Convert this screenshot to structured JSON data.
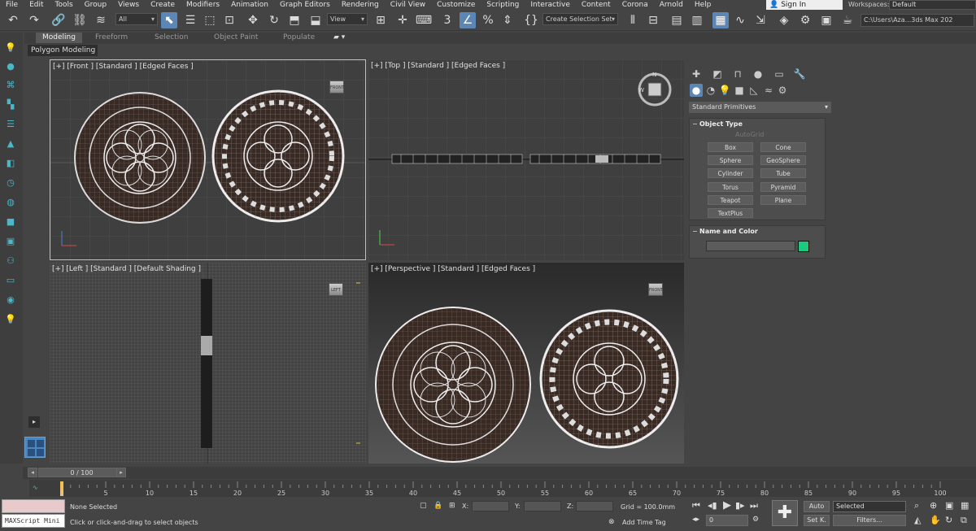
{
  "menu": [
    "File",
    "Edit",
    "Tools",
    "Group",
    "Views",
    "Create",
    "Modifiers",
    "Animation",
    "Graph Editors",
    "Rendering",
    "Civil View",
    "Customize",
    "Scripting",
    "Interactive",
    "Content",
    "Corona",
    "Arnold",
    "Help"
  ],
  "account": {
    "sign_in": "Sign In",
    "workspaces_label": "Workspaces:",
    "workspace": "Default"
  },
  "toolbar": {
    "filter_select": "All",
    "ref_coord": "View",
    "selection_set": "Create Selection Set",
    "project_path": "C:\\Users\\Aza...3ds Max 202"
  },
  "ribbon": {
    "tabs": [
      "Modeling",
      "Freeform",
      "Selection",
      "Object Paint",
      "Populate"
    ],
    "active_sub": "Polygon Modeling"
  },
  "viewports": {
    "front": "[+] [Front ] [Standard ] [Edged Faces ]",
    "top": "[+] [Top ] [Standard ] [Edged Faces ]",
    "left": "[+] [Left ] [Standard ] [Default Shading ]",
    "perspective": "[+] [Perspective ] [Standard ] [Edged Faces ]"
  },
  "command_panel": {
    "category": "Standard Primitives",
    "object_type_title": "Object Type",
    "autogrid": "AutoGrid",
    "buttons": [
      "Box",
      "Cone",
      "Sphere",
      "GeoSphere",
      "Cylinder",
      "Tube",
      "Torus",
      "Pyramid",
      "Teapot",
      "Plane",
      "TextPlus"
    ],
    "name_color_title": "Name and Color",
    "object_color": "#1ec87f"
  },
  "timeline": {
    "frame_display": "0 / 100",
    "ticks": [
      "0",
      "5",
      "10",
      "15",
      "20",
      "25",
      "30",
      "35",
      "40",
      "45",
      "50",
      "55",
      "60",
      "65",
      "70",
      "75",
      "80",
      "85",
      "90",
      "95",
      "100"
    ]
  },
  "status": {
    "maxscript": "MAXScript Mini",
    "selection": "None Selected",
    "prompt": "Click or click-and-drag to select objects",
    "x_label": "X:",
    "y_label": "Y:",
    "z_label": "Z:",
    "grid": "Grid = 100.0mm",
    "add_time_tag": "Add Time Tag",
    "auto_key": "Auto",
    "set_key": "Set K.",
    "key_filter": "Selected",
    "filters": "Filters...",
    "current_frame": "0"
  }
}
